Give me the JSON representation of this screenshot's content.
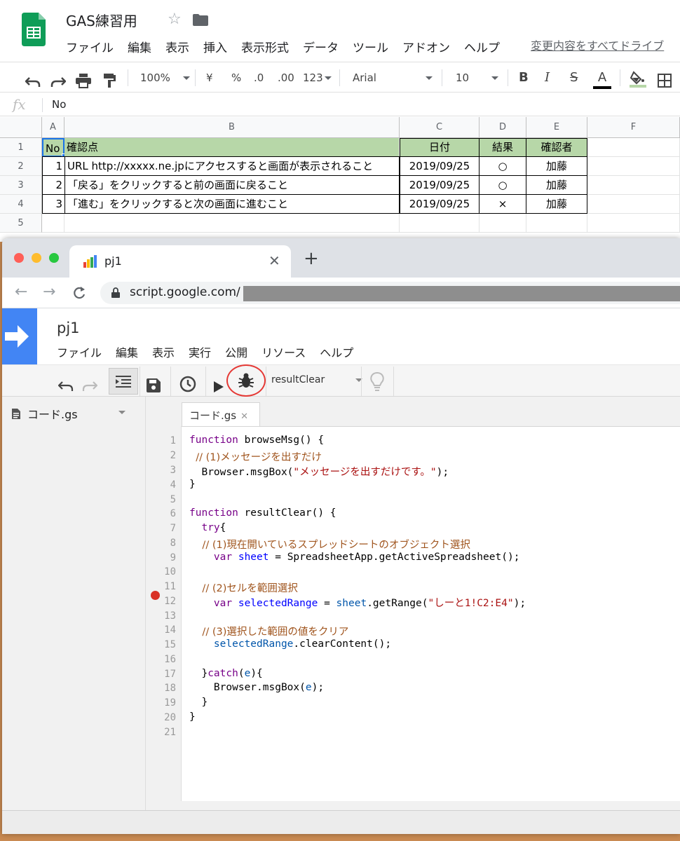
{
  "sheets": {
    "doc_title": "GAS練習用",
    "menu": [
      "ファイル",
      "編集",
      "表示",
      "挿入",
      "表示形式",
      "データ",
      "ツール",
      "アドオン",
      "ヘルプ"
    ],
    "change_link": "変更内容をすべてドライブ",
    "toolbar": {
      "zoom": "100%",
      "currency": "¥",
      "percent": "%",
      "dec_decrease": ".0",
      "dec_increase": ".00",
      "format_more": "123",
      "font": "Arial",
      "font_size": "10",
      "bold": "B",
      "italic": "I",
      "strike": "S",
      "text_color": "A"
    },
    "formula_bar": {
      "fx": "fx",
      "value": "No"
    },
    "columns": [
      "A",
      "B",
      "C",
      "D",
      "E",
      "F"
    ],
    "rows": [
      "1",
      "2",
      "3",
      "4",
      "5"
    ],
    "header_row": [
      "No",
      "確認点",
      "日付",
      "結果",
      "確認者"
    ],
    "data_rows": [
      [
        "1",
        "URL http://xxxxx.ne.jpにアクセスすると画面が表示されること",
        "2019/09/25",
        "○",
        "加藤"
      ],
      [
        "2",
        "「戻る」をクリックすると前の画面に戻ること",
        "2019/09/25",
        "○",
        "加藤"
      ],
      [
        "3",
        "「進む」をクリックすると次の画面に進むこと",
        "2019/09/25",
        "×",
        "加藤"
      ]
    ]
  },
  "browser": {
    "tab_title": "pj1",
    "url": "script.google.com/"
  },
  "gas": {
    "project": "pj1",
    "menu": [
      "ファイル",
      "編集",
      "表示",
      "実行",
      "公開",
      "リソース",
      "ヘルプ"
    ],
    "function_select": "resultClear",
    "file_name": "コード.gs",
    "editor_tab": "コード.gs",
    "line_numbers": [
      "1",
      "2",
      "3",
      "4",
      "5",
      "6",
      "7",
      "8",
      "9",
      "10",
      "11",
      "12",
      "13",
      "14",
      "15",
      "16",
      "17",
      "18",
      "19",
      "20",
      "21"
    ],
    "code": {
      "l1_kw": "function",
      "l1_rest": " browseMsg() {",
      "l2": "  // (1)メッセージを出すだけ",
      "l3_a": "  Browser.msgBox(",
      "l3_str": "\"メッセージを出すだけです。\"",
      "l3_b": ");",
      "l4": "}",
      "l6_kw": "function",
      "l6_rest": " resultClear() {",
      "l7_kw": "  try",
      "l7_rest": "{",
      "l8": "    // (1)現在開いているスプレッドシートのオブジェクト選択",
      "l9_kw": "    var ",
      "l9_var": "sheet",
      "l9_rest": " = SpreadsheetApp.getActiveSpreadsheet();",
      "l11": "    // (2)セルを範囲選択",
      "l12_kw": "    var ",
      "l12_var": "selectedRange",
      "l12_mid": " = ",
      "l12_var2": "sheet",
      "l12_call": ".getRange(",
      "l12_str": "\"しーと1!C2:E4\"",
      "l12_end": ");",
      "l14": "    // (3)選択した範囲の値をクリア",
      "l15_var": "    selectedRange",
      "l15_rest": ".clearContent();",
      "l17_a": "  }",
      "l17_kw": "catch",
      "l17_b": "(",
      "l17_e": "e",
      "l17_c": "){",
      "l18_a": "    Browser.msgBox(",
      "l18_e": "e",
      "l18_b": ");",
      "l19": "  }",
      "l20": "}"
    },
    "breakpoint_line": 12
  },
  "colors": {
    "header_fill": "#b7d7a8",
    "gas_blue": "#4285f4",
    "debug_highlight": "#e53935"
  }
}
